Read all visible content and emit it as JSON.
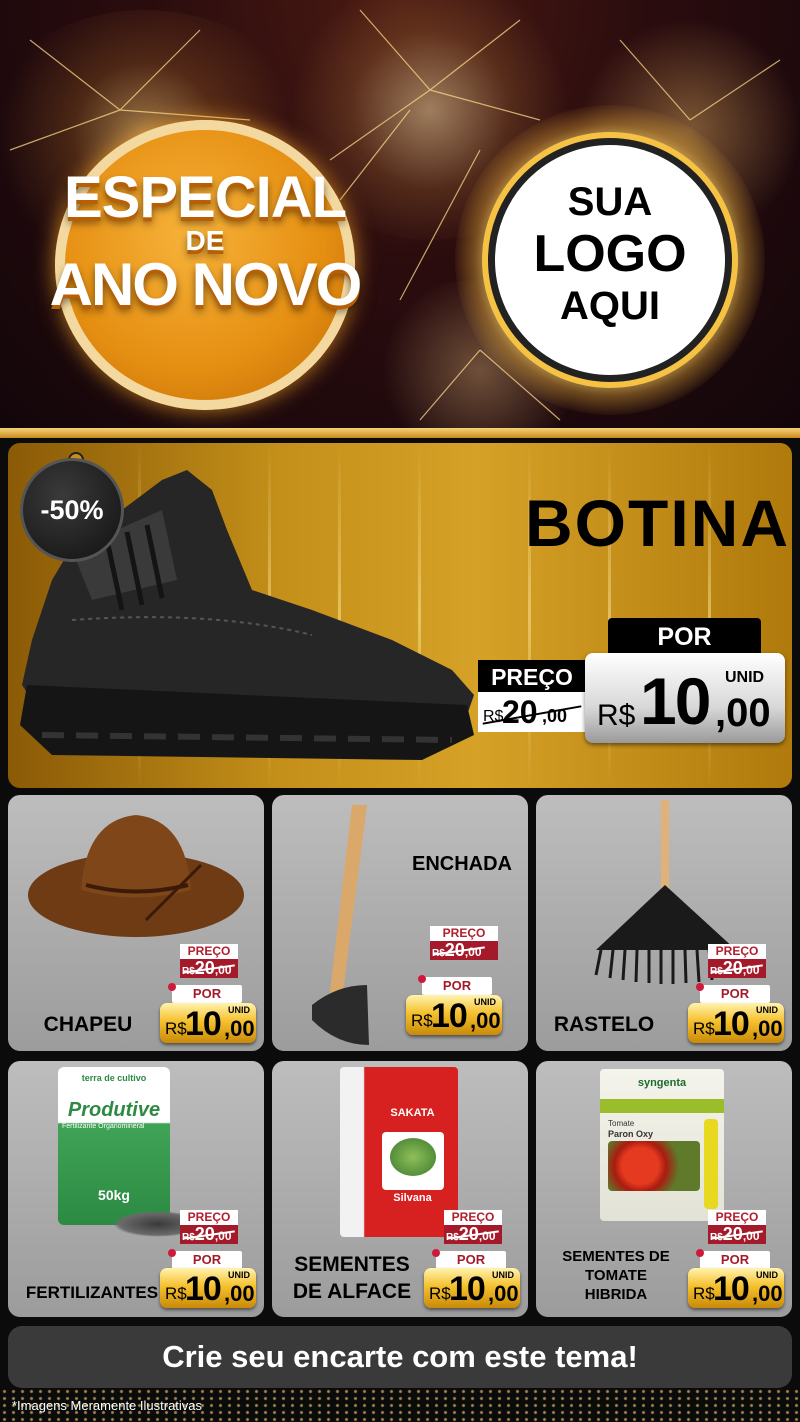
{
  "header": {
    "title_line1": "ESPECIAL",
    "title_line2": "DE",
    "title_line3": "ANO NOVO",
    "logo_line1": "SUA",
    "logo_line2": "LOGO",
    "logo_line3": "AQUI"
  },
  "hero": {
    "discount": "-50%",
    "product_name": "BOTINA",
    "old_label": "PREÇO",
    "old_currency": "R$",
    "old_int": "20",
    "old_dec": ",00",
    "new_label": "POR",
    "new_currency": "R$",
    "new_int": "10",
    "new_dec": ",00",
    "unit": "UNID"
  },
  "products": [
    {
      "name": "CHAPEU",
      "old_label": "PREÇO",
      "old_currency": "R$",
      "old_int": "20",
      "old_dec": ",00",
      "new_label": "POR",
      "new_currency": "R$",
      "new_int": "10",
      "new_dec": ",00",
      "unit": "UNID"
    },
    {
      "name": "ENCHADA",
      "old_label": "PREÇO",
      "old_currency": "R$",
      "old_int": "20",
      "old_dec": ",00",
      "new_label": "POR",
      "new_currency": "R$",
      "new_int": "10",
      "new_dec": ",00",
      "unit": "UNID"
    },
    {
      "name": "RASTELO",
      "old_label": "PREÇO",
      "old_currency": "R$",
      "old_int": "20",
      "old_dec": ",00",
      "new_label": "POR",
      "new_currency": "R$",
      "new_int": "10",
      "new_dec": ",00",
      "unit": "UNID"
    },
    {
      "name": "FERTILIZANTES",
      "old_label": "PREÇO",
      "old_currency": "R$",
      "old_int": "20",
      "old_dec": ",00",
      "new_label": "POR",
      "new_currency": "R$",
      "new_int": "10",
      "new_dec": ",00",
      "unit": "UNID"
    },
    {
      "name_line1": "SEMENTES",
      "name_line2": "DE ALFACE",
      "old_label": "PREÇO",
      "old_currency": "R$",
      "old_int": "20",
      "old_dec": ",00",
      "new_label": "POR",
      "new_currency": "R$",
      "new_int": "10",
      "new_dec": ",00",
      "unit": "UNID"
    },
    {
      "name_line1": "SEMENTES DE",
      "name_line2": "TOMATE",
      "name_line3": "HIBRIDA",
      "old_label": "PREÇO",
      "old_currency": "R$",
      "old_int": "20",
      "old_dec": ",00",
      "new_label": "POR",
      "new_currency": "R$",
      "new_int": "10",
      "new_dec": ",00",
      "unit": "UNID"
    }
  ],
  "packaging": {
    "fert_brand": "terra de cultivo",
    "fert_product": "Produtive",
    "fert_sub": "Fertilizante Organomineral",
    "fert_weight": "50kg",
    "lettuce_brand": "SAKATA",
    "lettuce_variety": "Silvana",
    "tomato_brand": "syngenta",
    "tomato_kind": "Tomate",
    "tomato_variety": "Paron Oxy"
  },
  "cta": {
    "label": "Crie seu encarte com este tema!"
  },
  "footer": {
    "note": "*Imagens Meramente Ilustrativas"
  },
  "colors": {
    "gold": "#c4901a",
    "dark_red": "#a51a2a",
    "price_yellow": "#f5c12e"
  }
}
